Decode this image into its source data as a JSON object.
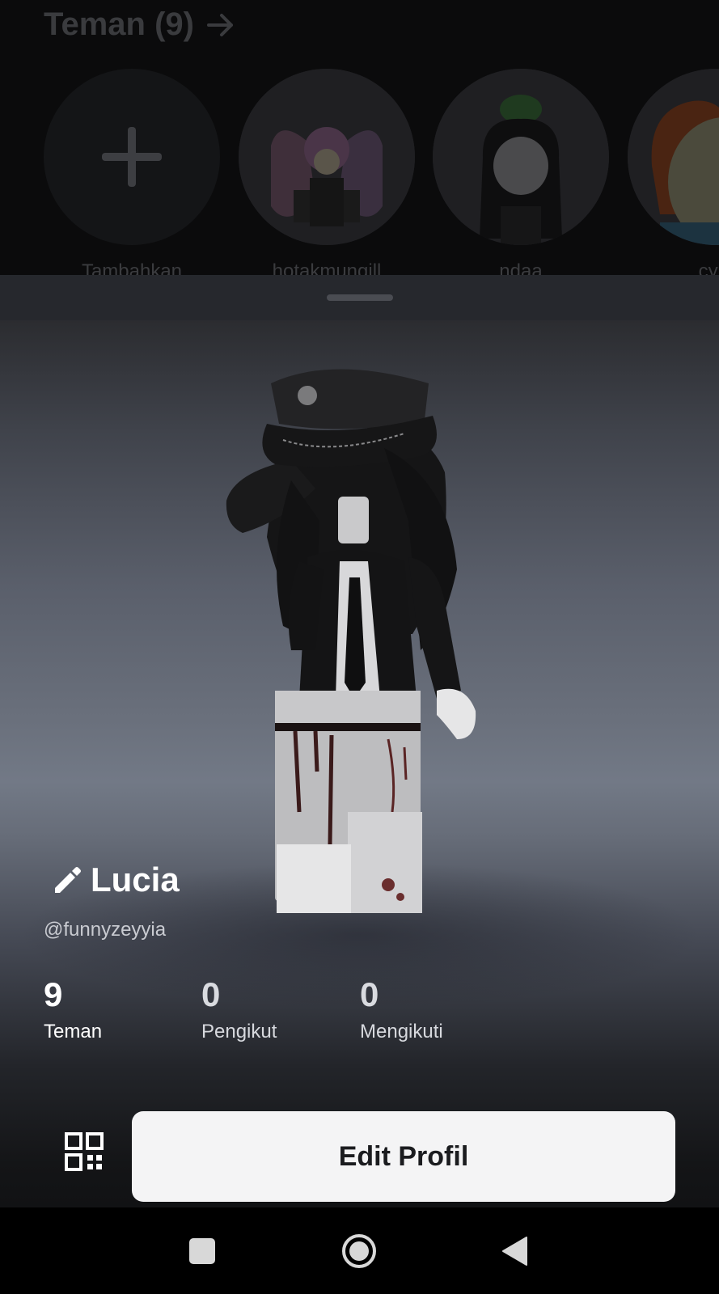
{
  "friends": {
    "title": "Teman (9)",
    "items": [
      {
        "name": "Tambahkan"
      },
      {
        "name": "hotakmungill"
      },
      {
        "name": "ndaa"
      },
      {
        "name": "cyle"
      }
    ]
  },
  "profile": {
    "display_name": "Lucia",
    "username": "@funnyzeyyia"
  },
  "stats": [
    {
      "value": "9",
      "label": "Teman"
    },
    {
      "value": "0",
      "label": "Pengikut"
    },
    {
      "value": "0",
      "label": "Mengikuti"
    }
  ],
  "actions": {
    "edit_profile_label": "Edit Profil"
  },
  "icons": {
    "add": "plus-icon",
    "arrow": "arrow-right-icon",
    "edit": "pencil-icon",
    "qr": "qr-code-icon",
    "nav_recents": "square-icon",
    "nav_home": "circle-icon",
    "nav_back": "triangle-icon"
  },
  "colors": {
    "sheet_background": "#1b1c1f",
    "button_background": "#f4f4f5",
    "button_text": "#1b1c1f",
    "dimmed_background": "#0b0b0c"
  }
}
